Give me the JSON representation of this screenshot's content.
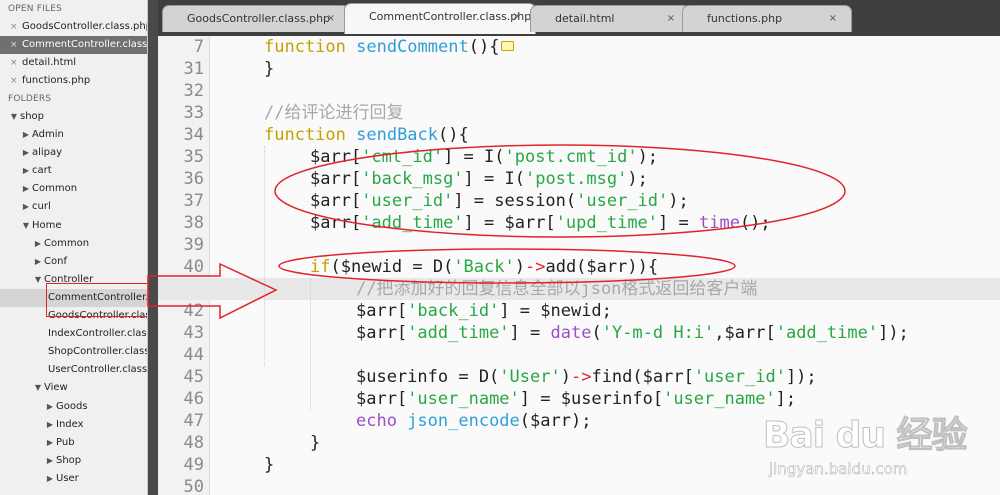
{
  "sidebar": {
    "open_files_header": "OPEN FILES",
    "open_files": [
      {
        "name": "GoodsController.class.php",
        "active": false
      },
      {
        "name": "CommentController.class.php",
        "active": true
      },
      {
        "name": "detail.html",
        "active": false
      },
      {
        "name": "functions.php",
        "active": false
      }
    ],
    "folders_header": "FOLDERS",
    "tree": [
      {
        "label": "shop",
        "depth": 0,
        "open": true
      },
      {
        "label": "Admin",
        "depth": 1,
        "open": false
      },
      {
        "label": "alipay",
        "depth": 1,
        "open": false
      },
      {
        "label": "cart",
        "depth": 1,
        "open": false
      },
      {
        "label": "Common",
        "depth": 1,
        "open": false
      },
      {
        "label": "curl",
        "depth": 1,
        "open": false
      },
      {
        "label": "Home",
        "depth": 1,
        "open": true
      },
      {
        "label": "Common",
        "depth": 2,
        "open": false
      },
      {
        "label": "Conf",
        "depth": 2,
        "open": false
      },
      {
        "label": "Controller",
        "depth": 2,
        "open": true
      },
      {
        "label": "CommentController.class.php",
        "depth": 3,
        "file": true,
        "selected": true
      },
      {
        "label": "GoodsController.class.php",
        "depth": 3,
        "file": true
      },
      {
        "label": "IndexController.class.php",
        "depth": 3,
        "file": true
      },
      {
        "label": "ShopController.class.php",
        "depth": 3,
        "file": true
      },
      {
        "label": "UserController.class.php",
        "depth": 3,
        "file": true
      },
      {
        "label": "View",
        "depth": 2,
        "open": true
      },
      {
        "label": "Goods",
        "depth": 3,
        "open": false
      },
      {
        "label": "Index",
        "depth": 3,
        "open": false
      },
      {
        "label": "Pub",
        "depth": 3,
        "open": false
      },
      {
        "label": "Shop",
        "depth": 3,
        "open": false
      },
      {
        "label": "User",
        "depth": 3,
        "open": false
      }
    ]
  },
  "tabs": [
    {
      "label": "GoodsController.class.php",
      "active": false,
      "close": "×"
    },
    {
      "label": "CommentController.class.php",
      "active": true,
      "close": "×"
    },
    {
      "label": "detail.html",
      "active": false,
      "close": "×"
    },
    {
      "label": "functions.php",
      "active": false,
      "close": "×"
    }
  ],
  "editor": {
    "lines": [
      {
        "n": "7",
        "indent": 1,
        "tokens": [
          [
            "kw",
            "function "
          ],
          [
            "fn",
            "sendComment"
          ],
          [
            "pl",
            "(){"
          ]
        ],
        "fold": true
      },
      {
        "n": "31",
        "indent": 1,
        "tokens": [
          [
            "pl",
            "}"
          ]
        ]
      },
      {
        "n": "32",
        "indent": 0,
        "tokens": []
      },
      {
        "n": "33",
        "indent": 1,
        "tokens": [
          [
            "cm",
            "//给评论进行回复"
          ]
        ]
      },
      {
        "n": "34",
        "indent": 1,
        "tokens": [
          [
            "kw",
            "function "
          ],
          [
            "fn",
            "sendBack"
          ],
          [
            "pl",
            "(){"
          ]
        ]
      },
      {
        "n": "35",
        "indent": 2,
        "tokens": [
          [
            "var",
            "$arr["
          ],
          [
            "str",
            "'cmt_id'"
          ],
          [
            "var",
            "] = I("
          ],
          [
            "str",
            "'post.cmt_id'"
          ],
          [
            "var",
            ");"
          ]
        ]
      },
      {
        "n": "36",
        "indent": 2,
        "tokens": [
          [
            "var",
            "$arr["
          ],
          [
            "str",
            "'back_msg'"
          ],
          [
            "var",
            "] = I("
          ],
          [
            "str",
            "'post.msg'"
          ],
          [
            "var",
            ");"
          ]
        ]
      },
      {
        "n": "37",
        "indent": 2,
        "tokens": [
          [
            "var",
            "$arr["
          ],
          [
            "str",
            "'user_id'"
          ],
          [
            "var",
            "] = session("
          ],
          [
            "str",
            "'user_id'"
          ],
          [
            "var",
            ");"
          ]
        ]
      },
      {
        "n": "38",
        "indent": 2,
        "tokens": [
          [
            "var",
            "$arr["
          ],
          [
            "str",
            "'add_time'"
          ],
          [
            "var",
            "] = $arr["
          ],
          [
            "str",
            "'upd_time'"
          ],
          [
            "var",
            "] = "
          ],
          [
            "bi",
            "time"
          ],
          [
            "var",
            "();"
          ]
        ]
      },
      {
        "n": "39",
        "indent": 0,
        "tokens": []
      },
      {
        "n": "40",
        "indent": 2,
        "tokens": [
          [
            "kw",
            "if"
          ],
          [
            "var",
            "($newid = D("
          ],
          [
            "str",
            "'Back'"
          ],
          [
            "var",
            ")"
          ],
          [
            "op",
            "->"
          ],
          [
            "var",
            "add($arr)){"
          ]
        ]
      },
      {
        "n": "41",
        "indent": 3,
        "tokens": [
          [
            "cm",
            "//把添加好的回复信息全部以json格式返回给客户端"
          ]
        ],
        "highlight": true
      },
      {
        "n": "42",
        "indent": 3,
        "tokens": [
          [
            "var",
            "$arr["
          ],
          [
            "str",
            "'back_id'"
          ],
          [
            "var",
            "] = $newid;"
          ]
        ]
      },
      {
        "n": "43",
        "indent": 3,
        "tokens": [
          [
            "var",
            "$arr["
          ],
          [
            "str",
            "'add_time'"
          ],
          [
            "var",
            "] = "
          ],
          [
            "bi",
            "date"
          ],
          [
            "var",
            "("
          ],
          [
            "str",
            "'Y-m-d H:i'"
          ],
          [
            "var",
            ",$arr["
          ],
          [
            "str",
            "'add_time'"
          ],
          [
            "var",
            "]);"
          ]
        ]
      },
      {
        "n": "44",
        "indent": 0,
        "tokens": []
      },
      {
        "n": "45",
        "indent": 3,
        "tokens": [
          [
            "var",
            "$userinfo = D("
          ],
          [
            "str",
            "'User'"
          ],
          [
            "var",
            ")"
          ],
          [
            "op",
            "->"
          ],
          [
            "var",
            "find($arr["
          ],
          [
            "str",
            "'user_id'"
          ],
          [
            "var",
            "]);"
          ]
        ]
      },
      {
        "n": "46",
        "indent": 3,
        "tokens": [
          [
            "var",
            "$arr["
          ],
          [
            "str",
            "'user_name'"
          ],
          [
            "var",
            "] = $userinfo["
          ],
          [
            "str",
            "'user_name'"
          ],
          [
            "var",
            "];"
          ]
        ]
      },
      {
        "n": "47",
        "indent": 3,
        "tokens": [
          [
            "bi",
            "echo "
          ],
          [
            "fn",
            "json_encode"
          ],
          [
            "var",
            "($arr);"
          ]
        ]
      },
      {
        "n": "48",
        "indent": 2,
        "tokens": [
          [
            "pl",
            "}"
          ]
        ]
      },
      {
        "n": "49",
        "indent": 1,
        "tokens": [
          [
            "pl",
            "}"
          ]
        ]
      },
      {
        "n": "50",
        "indent": 0,
        "tokens": []
      }
    ]
  },
  "watermark": {
    "logo": "Bai du 经验",
    "url": "jingyan.baidu.com"
  },
  "colors": {
    "annotation": "#e0242a",
    "keyword": "#c5a000",
    "function": "#2f9ed8",
    "string": "#28a745"
  }
}
